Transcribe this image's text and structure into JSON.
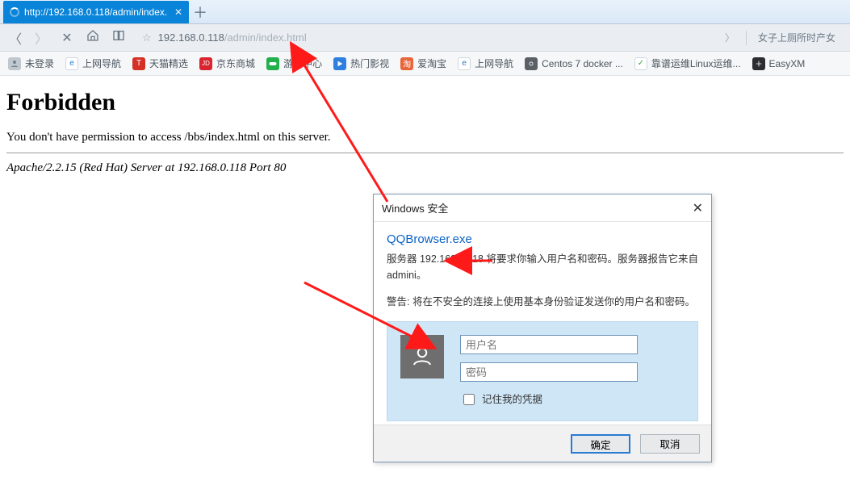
{
  "tab": {
    "title": "http://192.168.0.118/admin/index."
  },
  "address": {
    "host": "192.168.0.118",
    "path": "/admin/index.html",
    "hot_text": "女子上厕所时产女"
  },
  "bookmarks": {
    "not_logged": "未登录",
    "nav": "上网导航",
    "tmall": "天猫精选",
    "jd": "京东商城",
    "game": "游戏中心",
    "video": "热门影视",
    "aitao": "爱淘宝",
    "nav2": "上网导航",
    "centos": "Centos 7 docker ...",
    "linux": "靠谱运维Linux运维...",
    "easy": "EasyXM",
    "jd_badge": "JD",
    "t_badge": "T",
    "e_badge": "e"
  },
  "page": {
    "h1": "Forbidden",
    "p": "You don't have permission to access /bbs/index.html on this server.",
    "server": "Apache/2.2.15 (Red Hat) Server at 192.168.0.118 Port 80"
  },
  "dialog": {
    "title": "Windows 安全",
    "app": "QQBrowser.exe",
    "msg": "服务器 192.168.0.118 将要求你输入用户名和密码。服务器报告它来自 admini。",
    "warn": "警告: 将在不安全的连接上使用基本身份验证发送你的用户名和密码。",
    "user_ph": "用户名",
    "pass_ph": "密码",
    "remember": "记住我的凭据",
    "ok": "确定",
    "cancel": "取消"
  }
}
